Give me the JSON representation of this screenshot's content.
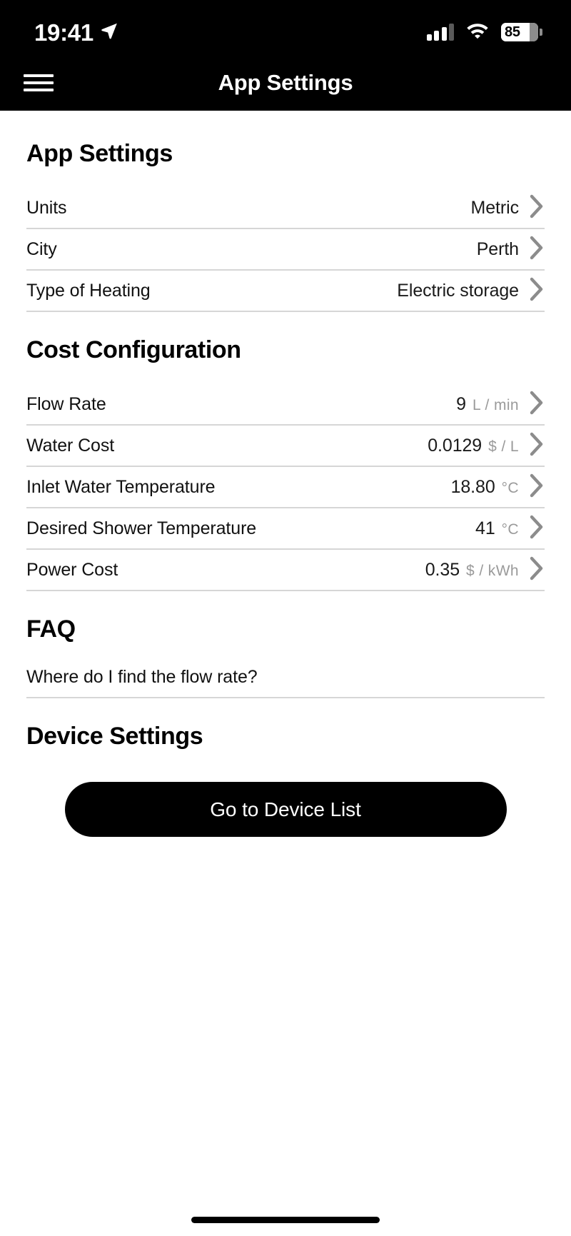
{
  "status_bar": {
    "time": "19:41",
    "location_icon": "location-arrow-icon",
    "signal_icon": "cellular-signal-icon",
    "wifi_icon": "wifi-icon",
    "battery_level": "85"
  },
  "nav": {
    "menu_icon": "hamburger-menu-icon",
    "title": "App Settings"
  },
  "app_settings": {
    "heading": "App Settings",
    "rows": [
      {
        "label": "Units",
        "value": "Metric",
        "unit": ""
      },
      {
        "label": "City",
        "value": "Perth",
        "unit": ""
      },
      {
        "label": "Type of Heating",
        "value": "Electric storage",
        "unit": ""
      }
    ]
  },
  "cost_configuration": {
    "heading": "Cost Configuration",
    "rows": [
      {
        "label": "Flow Rate",
        "value": "9",
        "unit": "L / min"
      },
      {
        "label": "Water Cost",
        "value": "0.0129",
        "unit": "$ / L"
      },
      {
        "label": "Inlet Water Temperature",
        "value": "18.80",
        "unit": "°C"
      },
      {
        "label": "Desired Shower Temperature",
        "value": "41",
        "unit": "°C"
      },
      {
        "label": "Power Cost",
        "value": "0.35",
        "unit": "$ / kWh"
      }
    ]
  },
  "faq": {
    "heading": "FAQ",
    "items": [
      {
        "label": "Where do I find the flow rate?"
      }
    ]
  },
  "device_settings": {
    "heading": "Device Settings",
    "button_label": "Go to Device List"
  },
  "colors": {
    "background": "#ffffff",
    "bar_background": "#000000",
    "text_primary": "#111111",
    "text_muted": "#9a9a9a",
    "divider": "#d6d6d6",
    "button_background": "#000000",
    "button_text": "#ffffff"
  }
}
